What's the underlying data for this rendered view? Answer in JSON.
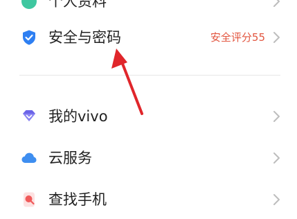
{
  "settings": {
    "items": [
      {
        "label": "个人资料",
        "value": ""
      },
      {
        "label": "安全与密码",
        "value": "安全评分55"
      },
      {
        "label": "我的vivo",
        "value": ""
      },
      {
        "label": "云服务",
        "value": ""
      },
      {
        "label": "查找手机",
        "value": ""
      }
    ]
  },
  "colors": {
    "accent_value": "#e2553f",
    "annotation_arrow": "#e0262b",
    "divider": "#e6e6e6"
  },
  "icons": {
    "profile": "profile-icon",
    "security": "shield-check-icon",
    "my_vivo": "diamond-icon",
    "cloud": "cloud-icon",
    "find_phone": "find-phone-icon"
  }
}
